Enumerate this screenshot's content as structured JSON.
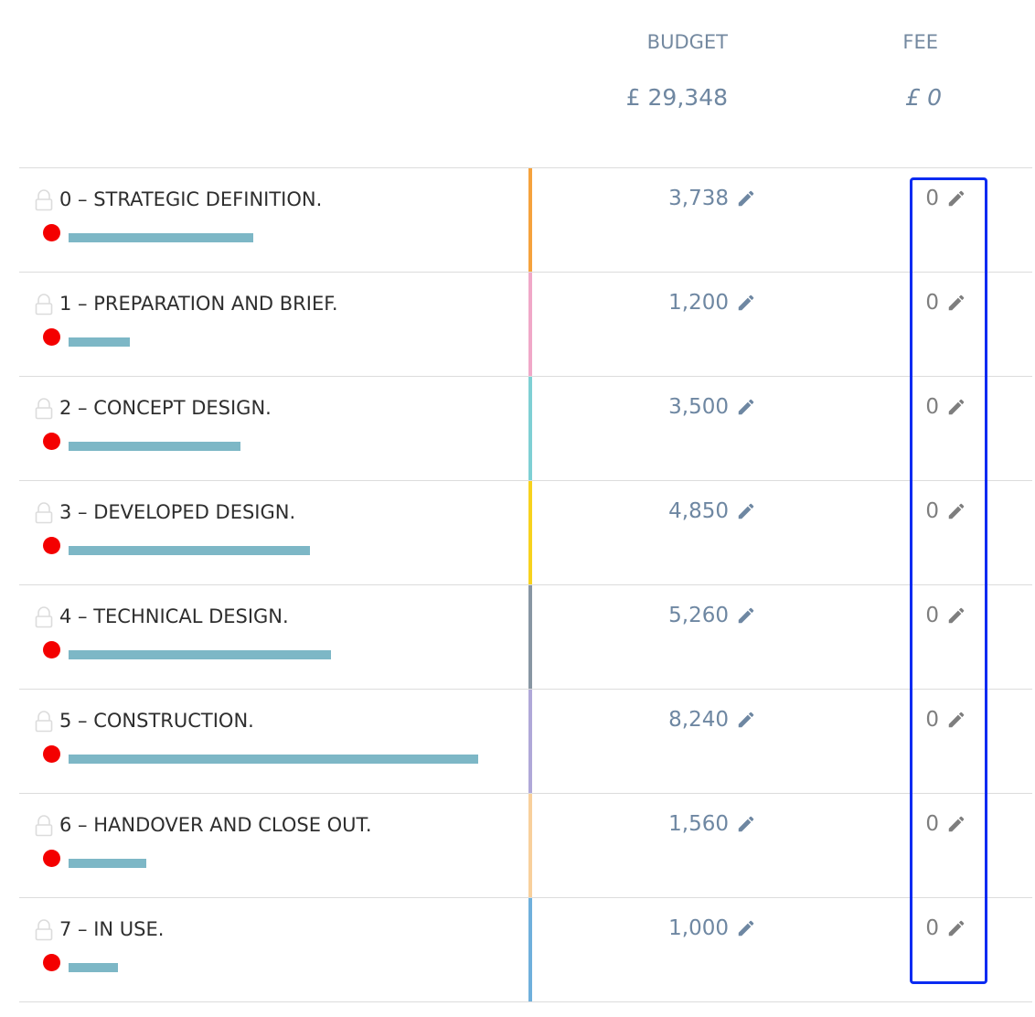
{
  "header": {
    "budget_label": "BUDGET",
    "fee_label": "FEE",
    "budget_total": "£ 29,348",
    "fee_total": "£ 0"
  },
  "colors": {
    "status_dot": "#f40000",
    "progress_bar": "#7db7c6",
    "highlight_border": "#0b2bf2"
  },
  "phases": [
    {
      "name": "0 – STRATEGIC DEFINITION.",
      "budget": "3,738",
      "fee": "0",
      "stripe_color": "#f5a23d",
      "progress": 0.45
    },
    {
      "name": "1 – PREPARATION AND BRIEF.",
      "budget": "1,200",
      "fee": "0",
      "stripe_color": "#f0a8c8",
      "progress": 0.15
    },
    {
      "name": "2 – CONCEPT DESIGN.",
      "budget": "3,500",
      "fee": "0",
      "stripe_color": "#7fd0d4",
      "progress": 0.42
    },
    {
      "name": "3 – DEVELOPED DESIGN.",
      "budget": "4,850",
      "fee": "0",
      "stripe_color": "#f7d21e",
      "progress": 0.59
    },
    {
      "name": "4 – TECHNICAL DESIGN.",
      "budget": "5,260",
      "fee": "0",
      "stripe_color": "#8896a3",
      "progress": 0.64
    },
    {
      "name": "5 – CONSTRUCTION.",
      "budget": "8,240",
      "fee": "0",
      "stripe_color": "#b0a8d8",
      "progress": 1.0
    },
    {
      "name": "6 – HANDOVER AND CLOSE OUT.",
      "budget": "1,560",
      "fee": "0",
      "stripe_color": "#f8d09c",
      "progress": 0.19
    },
    {
      "name": "7 – IN USE.",
      "budget": "1,000",
      "fee": "0",
      "stripe_color": "#6fb0dc",
      "progress": 0.12
    }
  ]
}
